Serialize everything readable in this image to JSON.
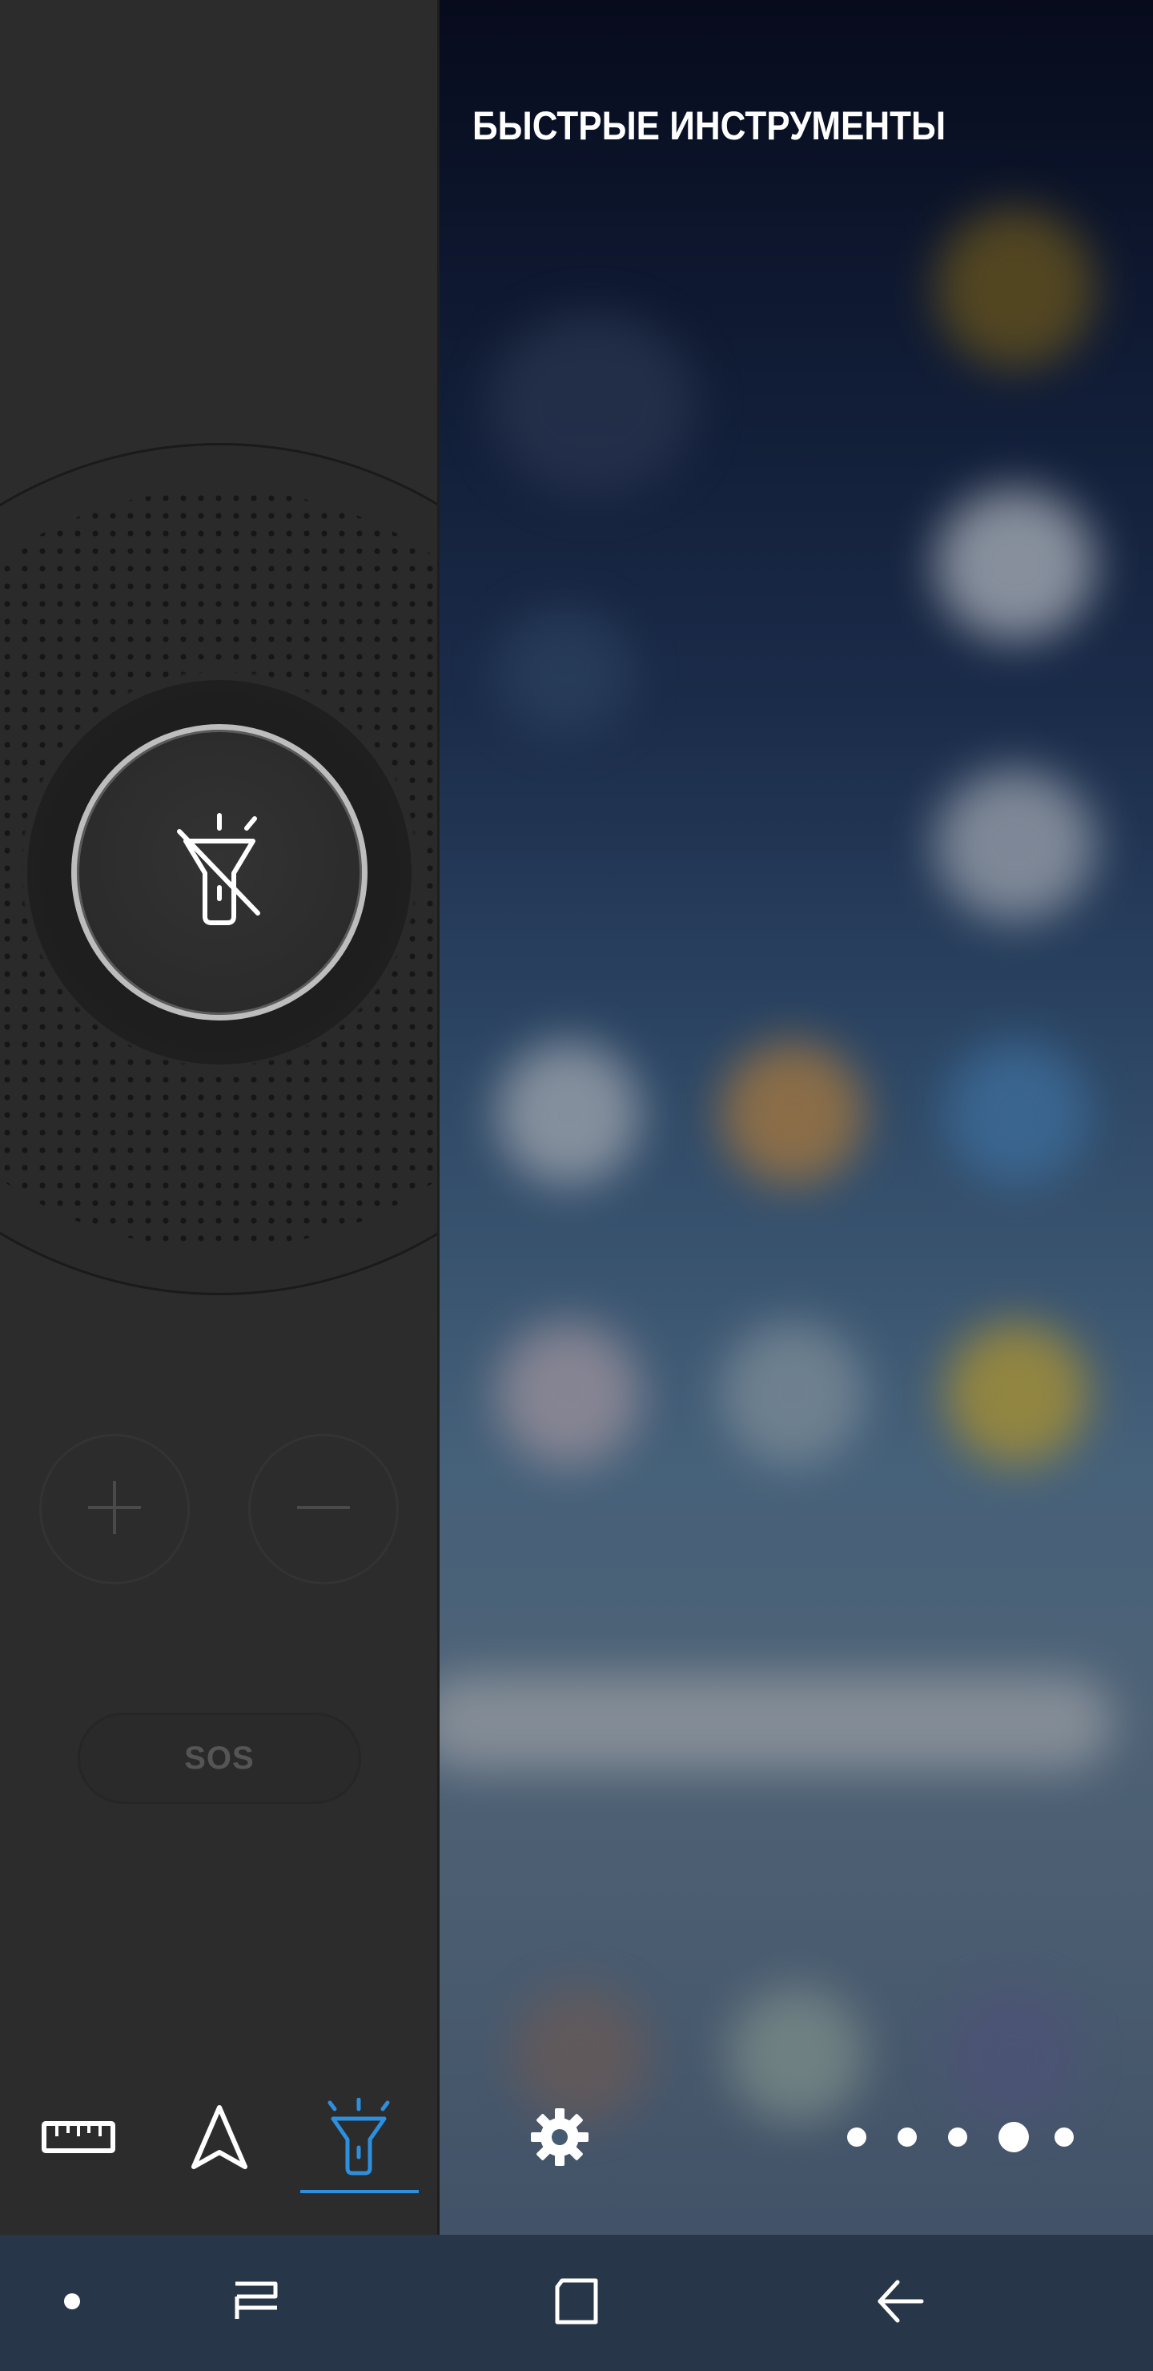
{
  "panel": {
    "title": "БЫСТРЫЕ ИНСТРУМЕНТЫ"
  },
  "flashlight": {
    "state": "off",
    "sos_label": "SOS"
  },
  "tools": [
    {
      "name": "ruler",
      "icon": "ruler-icon",
      "active": false
    },
    {
      "name": "compass",
      "icon": "compass-icon",
      "active": false
    },
    {
      "name": "flashlight",
      "icon": "flashlight-icon",
      "active": true
    }
  ],
  "pager": {
    "count": 5,
    "active_index": 3
  },
  "nav_bar": {
    "items": [
      "dot",
      "recents",
      "home",
      "back"
    ]
  },
  "colors": {
    "panel_bg": "#2c2c2c",
    "accent": "#2d8fde",
    "nav_bg": "#283649",
    "ring": "#bdbdbd"
  }
}
